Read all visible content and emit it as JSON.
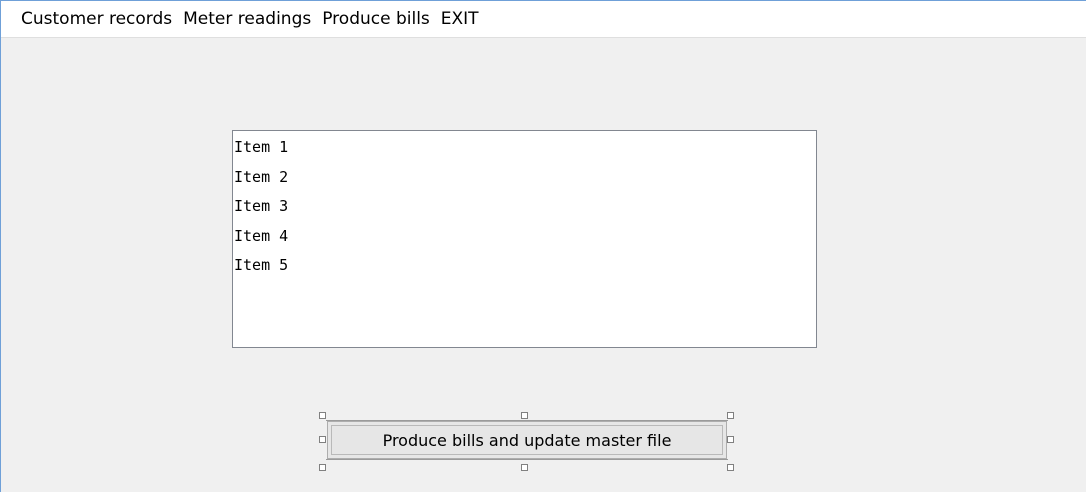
{
  "menubar": {
    "items": [
      {
        "label": "Customer records"
      },
      {
        "label": "Meter readings"
      },
      {
        "label": "Produce bills"
      },
      {
        "label": "EXIT"
      }
    ]
  },
  "listbox": {
    "items": [
      "Item 1",
      "Item 2",
      "Item 3",
      "Item 4",
      "Item 5"
    ]
  },
  "button": {
    "label": "Produce bills and update master file"
  },
  "colors": {
    "window_background": "#f0f0f0",
    "menubar_background": "#ffffff",
    "listbox_border": "#828790",
    "window_border_accent": "#6fa0d8"
  }
}
